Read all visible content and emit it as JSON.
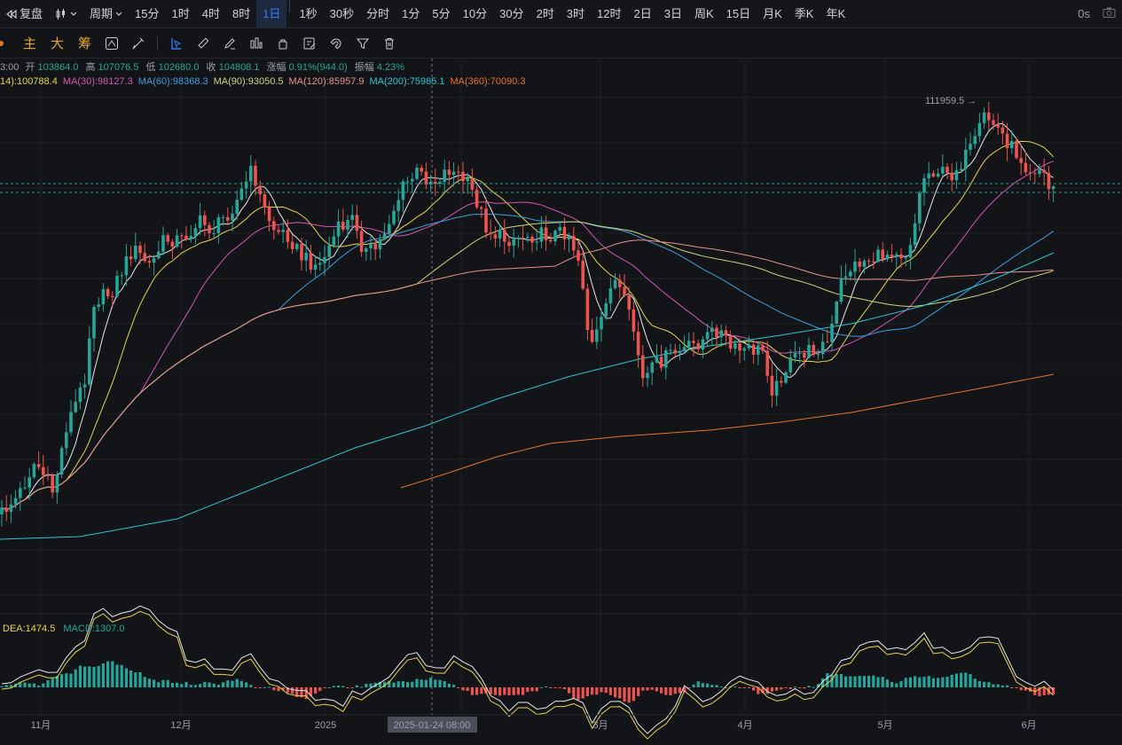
{
  "topbar": {
    "back_label": "复盘",
    "chart_type_label": "",
    "period_label": "周期",
    "intervals": [
      "15分",
      "1时",
      "4时",
      "8时",
      "1日",
      "1秒",
      "30秒",
      "分时",
      "1分",
      "5分",
      "10分",
      "30分",
      "2时",
      "3时",
      "12时",
      "2日",
      "3日",
      "周K",
      "15日",
      "月K",
      "季K",
      "年K"
    ],
    "active_interval": "1日",
    "countdown": "0s"
  },
  "toolbar": {
    "indicators": [
      "主",
      "大",
      "筹"
    ]
  },
  "ohlc": {
    "time_fragment": "3:00",
    "open_label": "开",
    "open": "103864.0",
    "high_label": "高",
    "high": "107076.5",
    "low_label": "低",
    "low": "102680.0",
    "close_label": "收",
    "close": "104808.1",
    "change_label": "涨幅",
    "change": "0.91%(944.0)",
    "amp_label": "振幅",
    "amp": "4.23%"
  },
  "ma_legend": [
    {
      "text": "14):100788.4",
      "color": "#e8d44d"
    },
    {
      "text": "MA(30):98127.3",
      "color": "#d257b8"
    },
    {
      "text": "MA(60):98368.3",
      "color": "#3d9fe0"
    },
    {
      "text": "MA(90):93050.5",
      "color": "#c8d87a"
    },
    {
      "text": "MA(120):85957.9",
      "color": "#e9918f"
    },
    {
      "text": "MA(200):75985.1",
      "color": "#29c6d6"
    },
    {
      "text": "MA(360):70090.3",
      "color": "#e4732c"
    }
  ],
  "macd_legend": {
    "dea": "DEA:1474.5",
    "macd": "MACD:1307.0"
  },
  "colors": {
    "up": "#26a69a",
    "down": "#ef5350",
    "bg": "#131417",
    "grid": "#1f2126",
    "ma_short": "#e8e8e8",
    "ma14": "#e8d44d",
    "ma30": "#d257b8",
    "ma60": "#3d9fe0",
    "ma90": "#c8d87a",
    "ma120": "#e9918f",
    "ma200": "#29c6d6",
    "ma360": "#e4732c",
    "dif": "#e8e8e8",
    "dea": "#e8d44d"
  },
  "chart_data": {
    "type": "candlestick",
    "peak_label": "111959.5 →",
    "crosshair_label": "2025-01-24 08:00",
    "x_labels": [
      "11月",
      "12月",
      "2025",
      "3月",
      "4月",
      "5月",
      "6月"
    ]
  }
}
